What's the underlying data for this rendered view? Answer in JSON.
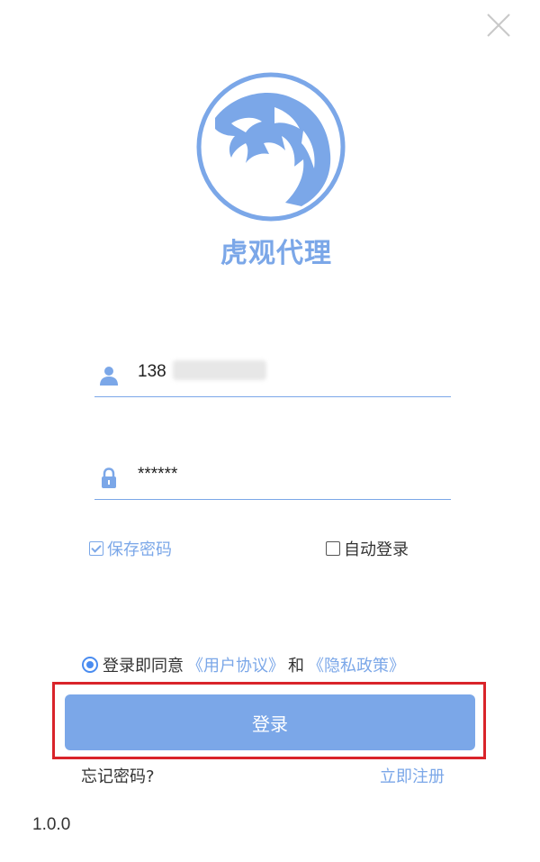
{
  "window": {
    "close_icon": "close-icon",
    "icon_color": "#c8c8c8"
  },
  "brand": {
    "logo_icon": "tiger-head-icon",
    "app_name": "虎观代理",
    "accent_color": "#7ba7e8"
  },
  "form": {
    "username": {
      "icon": "user-icon",
      "value": "138"
    },
    "password": {
      "icon": "lock-icon",
      "value": "******"
    },
    "save_password": {
      "label": "保存密码",
      "checked": true
    },
    "auto_login": {
      "label": "自动登录",
      "checked": false
    }
  },
  "agreement": {
    "selected": true,
    "prefix": "登录即同意",
    "user_agreement": "《用户协议》",
    "conjunction": "和",
    "privacy_policy": "《隐私政策》"
  },
  "actions": {
    "login_label": "登录",
    "forgot_password": "忘记密码?",
    "register": "立即注册"
  },
  "footer": {
    "version": "1.0.0"
  },
  "annotation": {
    "highlight_color": "#d9242a"
  }
}
